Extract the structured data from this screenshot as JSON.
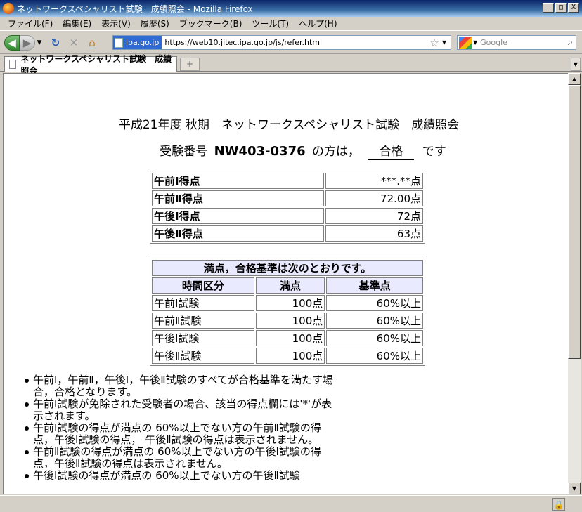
{
  "window": {
    "title": "ネットワークスペシャリスト試験　成績照会 - Mozilla Firefox",
    "min": "_",
    "max": "□",
    "close": "X"
  },
  "menu": [
    "ファイル(F)",
    "編集(E)",
    "表示(V)",
    "履歴(S)",
    "ブックマーク(B)",
    "ツール(T)",
    "ヘルプ(H)"
  ],
  "nav": {
    "site_badge": "ipa.go.jp",
    "url": "https://web10.jitec.ipa.go.jp/js/refer.html",
    "search_placeholder": "Google"
  },
  "tab": {
    "title": "ネットワークスペシャリスト試験　成績照会",
    "new_tab": "+"
  },
  "page": {
    "title": "平成21年度 秋期　ネットワークスペシャリスト試験　成績照会",
    "result_prefix": "受験番号",
    "exam_number": "NW403-0376",
    "result_mid": "の方は，",
    "result": "合格",
    "result_suffix": "です",
    "scores": [
      {
        "label": "午前Ⅰ得点",
        "value": "***.**点"
      },
      {
        "label": "午前Ⅱ得点",
        "value": "72.00点"
      },
      {
        "label": "午後Ⅰ得点",
        "value": "72点"
      },
      {
        "label": "午後Ⅱ得点",
        "value": "63点"
      }
    ],
    "criteria": {
      "caption": "満点，合格基準は次のとおりです。",
      "headers": [
        "時間区分",
        "満点",
        "基準点"
      ],
      "rows": [
        [
          "午前Ⅰ試験",
          "100点",
          "60%以上"
        ],
        [
          "午前Ⅱ試験",
          "100点",
          "60%以上"
        ],
        [
          "午後Ⅰ試験",
          "100点",
          "60%以上"
        ],
        [
          "午後Ⅱ試験",
          "100点",
          "60%以上"
        ]
      ]
    },
    "notes": [
      "午前Ⅰ，午前Ⅱ，午後Ⅰ，午後Ⅱ試験のすべてが合格基準を満たす場合，合格となります。",
      "午前Ⅰ試験が免除された受験者の場合、該当の得点欄には'*'が表示されます。",
      "午前Ⅰ試験の得点が満点の 60%以上でない方の午前Ⅱ試験の得点，午後Ⅰ試験の得点， 午後Ⅱ試験の得点は表示されません。",
      "午前Ⅱ試験の得点が満点の 60%以上でない方の午後Ⅰ試験の得点，午後Ⅱ試験の得点は表示されません。",
      "午後Ⅰ試験の得点が満点の 60%以上でない方の午後Ⅱ試験"
    ]
  }
}
